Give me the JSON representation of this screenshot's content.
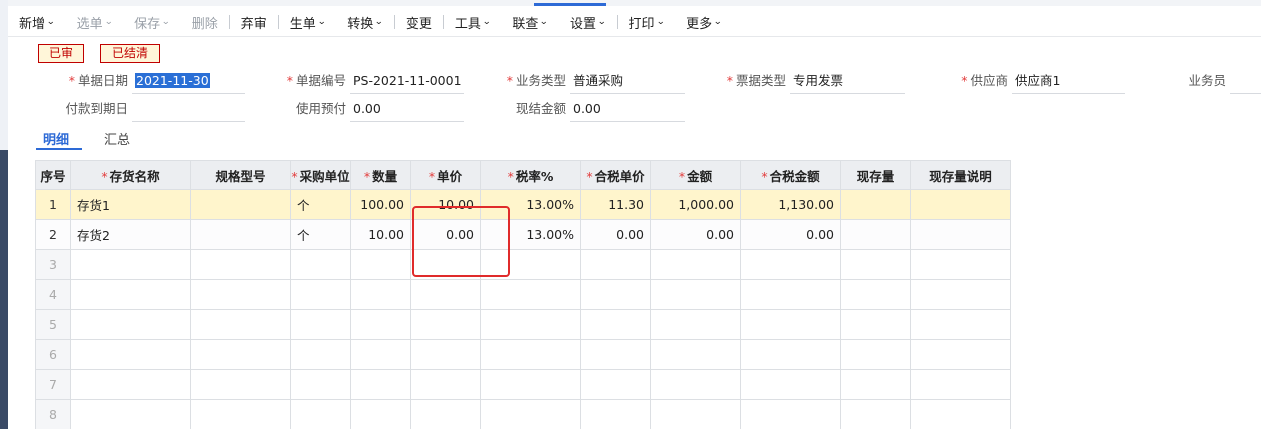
{
  "toolbar": {
    "items": [
      {
        "label": "新增",
        "caret": true,
        "disabled": false
      },
      {
        "label": "选单",
        "caret": true,
        "disabled": true
      },
      {
        "label": "保存",
        "caret": true,
        "disabled": true
      },
      {
        "label": "删除",
        "caret": false,
        "disabled": true
      },
      {
        "label": "弃审",
        "caret": false,
        "disabled": false
      },
      {
        "label": "生单",
        "caret": true,
        "disabled": false
      },
      {
        "label": "转换",
        "caret": true,
        "disabled": false
      },
      {
        "label": "变更",
        "caret": false,
        "disabled": false
      },
      {
        "label": "工具",
        "caret": true,
        "disabled": false
      },
      {
        "label": "联查",
        "caret": true,
        "disabled": false
      },
      {
        "label": "设置",
        "caret": true,
        "disabled": false
      },
      {
        "label": "打印",
        "caret": true,
        "disabled": false
      },
      {
        "label": "更多",
        "caret": true,
        "disabled": false
      }
    ],
    "caret_glyph": "⌄"
  },
  "badges": {
    "approved": "已审",
    "settled": "已结清"
  },
  "form": {
    "doc_date_label": "单据日期",
    "doc_date_value": "2021-11-30",
    "doc_no_label": "单据编号",
    "doc_no_value": "PS-2021-11-0001",
    "biz_type_label": "业务类型",
    "biz_type_value": "普通采购",
    "invoice_type_label": "票据类型",
    "invoice_type_value": "专用发票",
    "supplier_label": "供应商",
    "supplier_value": "供应商1",
    "salesman_label": "业务员",
    "salesman_value": "",
    "pay_due_label": "付款到期日",
    "pay_due_value": "",
    "prepaid_label": "使用预付",
    "prepaid_value": "0.00",
    "cash_label": "现结金额",
    "cash_value": "0.00",
    "required_mark": "*"
  },
  "tabs": {
    "detail": "明细",
    "summary": "汇总"
  },
  "table": {
    "columns": [
      {
        "label": "序号",
        "required": false
      },
      {
        "label": "存货名称",
        "required": true
      },
      {
        "label": "规格型号",
        "required": false
      },
      {
        "label": "采购单位",
        "required": true
      },
      {
        "label": "数量",
        "required": true
      },
      {
        "label": "单价",
        "required": true
      },
      {
        "label": "税率%",
        "required": true
      },
      {
        "label": "合税单价",
        "required": true
      },
      {
        "label": "金额",
        "required": true
      },
      {
        "label": "合税金额",
        "required": true
      },
      {
        "label": "现存量",
        "required": false
      },
      {
        "label": "现存量说明",
        "required": false
      }
    ],
    "rows": [
      [
        "1",
        "存货1",
        "",
        "个",
        "100.00",
        "10.00",
        "13.00%",
        "11.30",
        "1,000.00",
        "1,130.00",
        "",
        ""
      ],
      [
        "2",
        "存货2",
        "",
        "个",
        "10.00",
        "0.00",
        "13.00%",
        "0.00",
        "0.00",
        "0.00",
        "",
        ""
      ]
    ],
    "empty_rows": [
      "3",
      "4",
      "5",
      "6",
      "7",
      "8"
    ]
  }
}
